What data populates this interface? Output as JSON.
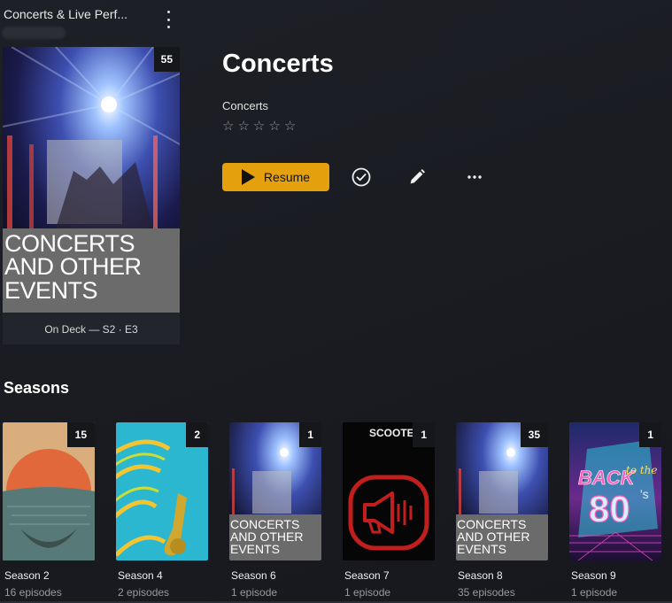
{
  "header": {
    "breadcrumb": "Concerts & Live Perf..."
  },
  "poster": {
    "badge": "55",
    "caption": "CONCERTS AND OTHER EVENTS",
    "on_deck": "On Deck — S2 · E3"
  },
  "show": {
    "title": "Concerts",
    "subtitle": "Concerts",
    "rating_stars": 5,
    "rating_value": 0
  },
  "actions": {
    "resume_label": "Resume",
    "icons": [
      "play-icon",
      "checkmark-icon",
      "pencil-icon",
      "more-options-icon"
    ]
  },
  "seasons": {
    "heading": "Seasons",
    "items": [
      {
        "label": "Season 2",
        "episodes": "16 episodes",
        "badge": "15"
      },
      {
        "label": "Season 4",
        "episodes": "2 episodes",
        "badge": "2"
      },
      {
        "label": "Season 6",
        "episodes": "1 episode",
        "badge": "1",
        "caption": "CONCERTS AND OTHER EVENTS"
      },
      {
        "label": "Season 7",
        "episodes": "1 episode",
        "badge": "1",
        "art_text": "SCOOTER"
      },
      {
        "label": "Season 8",
        "episodes": "35 episodes",
        "badge": "35",
        "caption": "CONCERTS AND OTHER EVENTS"
      },
      {
        "label": "Season 9",
        "episodes": "1 episode",
        "badge": "1",
        "art_text": "BACK to the 80's"
      }
    ]
  },
  "colors": {
    "accent": "#e5a00d",
    "background": "#1b1d22",
    "badge_bg": "#15171b",
    "muted_text": "#9a9a9a"
  }
}
